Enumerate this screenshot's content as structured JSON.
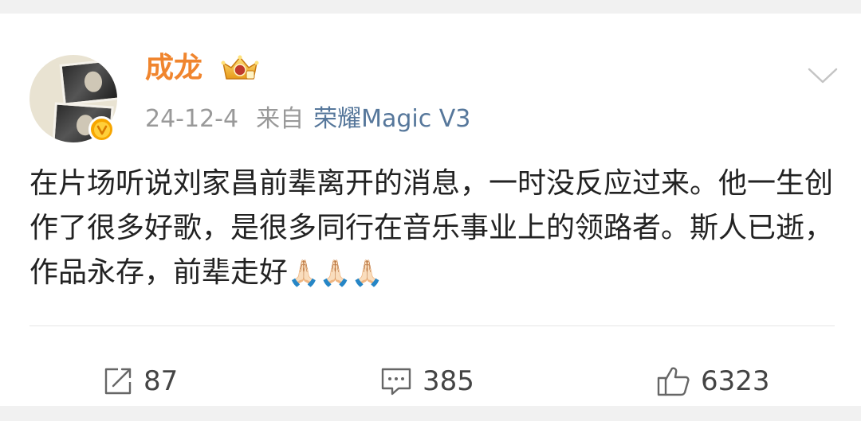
{
  "post": {
    "username": "成龙",
    "date": "24-12-4",
    "source_prefix": "来自",
    "source": "荣耀Magic V3",
    "content_text": "在片场听说刘家昌前辈离开的消息，一时没反应过来。他一生创作了很多好歌，是很多同行在音乐事业上的领路者。斯人已逝，作品永存，前辈走好",
    "content_emoji": "🙏🏻🙏🏻🙏🏻"
  },
  "actions": {
    "repost_count": "87",
    "comment_count": "385",
    "like_count": "6323"
  },
  "colors": {
    "username": "#f0852e",
    "source_link": "#56779b",
    "meta": "#999999",
    "text": "#222222",
    "verified": "#f7a600"
  },
  "icons": {
    "verified": "verified-v-icon",
    "crown": "crown-membership-icon",
    "more": "chevron-down-icon",
    "repost": "repost-icon",
    "comment": "comment-icon",
    "like": "thumbs-up-icon"
  }
}
